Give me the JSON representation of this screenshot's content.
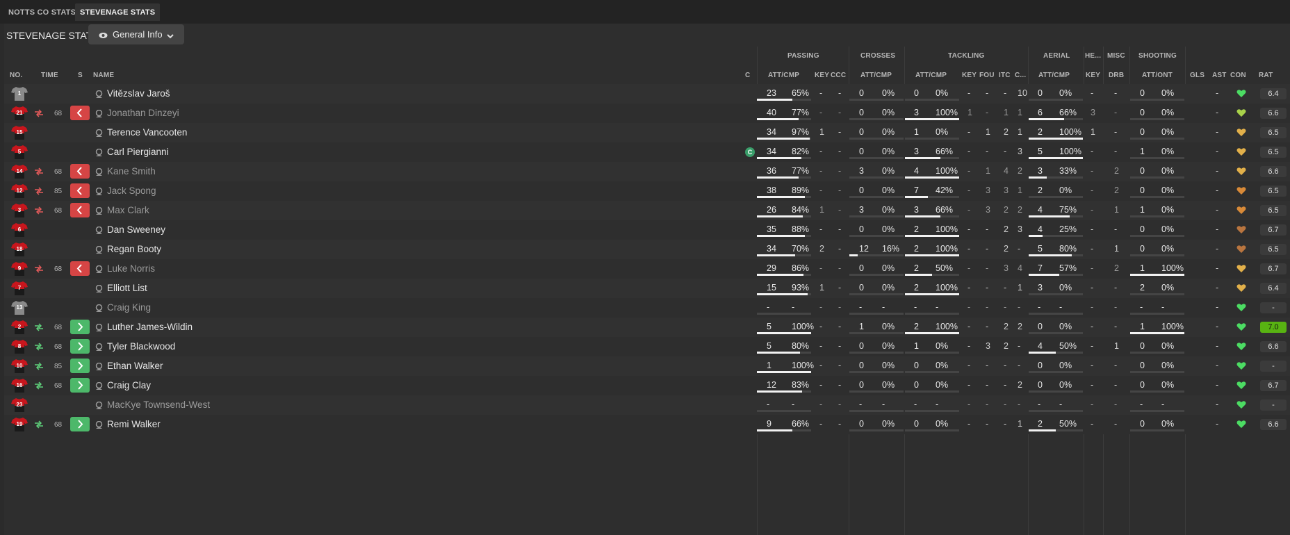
{
  "tabs": [
    {
      "label": "NOTTS CO STATS",
      "active": false
    },
    {
      "label": "STEVENAGE STATS",
      "active": true
    }
  ],
  "panel_title": "STEVENAGE STATS",
  "view_selector": {
    "label": "General Info",
    "icon": "eye-icon"
  },
  "group_headers": {
    "passing": "PASSING",
    "crosses": "CROSSES",
    "tackling": "TACKLING",
    "aerial": "AERIAL",
    "headers": "HE...",
    "misc": "MISC",
    "shooting": "SHOOTING"
  },
  "columns": {
    "no": "NO.",
    "time": "TIME",
    "s": "S",
    "name": "NAME",
    "c": "C",
    "pass_attcmp": "ATT/CMP",
    "pass_key": "KEY",
    "pass_ccc": "CCC",
    "cross_attcmp": "ATT/CMP",
    "tack_attcmp": "ATT/CMP",
    "tack_key": "KEY",
    "tack_fou": "FOU",
    "tack_itc": "ITC",
    "tack_c": "C...",
    "aer_attcmp": "ATT/CMP",
    "head_key": "KEY",
    "misc_drb": "DRB",
    "shoot_attont": "ATT/ONT",
    "gls": "GLS",
    "ast": "AST",
    "con": "CON",
    "rat": "RAT"
  },
  "colors": {
    "sub_off": "#d64545",
    "sub_on": "#4db86a",
    "shirt_red": "#c8161d",
    "shirt_grey": "#8a8a8a",
    "rating_best": "#58b312",
    "captain": "#3a9e6a"
  },
  "players": [
    {
      "no": "1",
      "shirt": "grey",
      "sub": "",
      "time": "",
      "name": "Vitězslav Jaroš",
      "dim": false,
      "captain": false,
      "p_att": "23",
      "p_pct": "65%",
      "p_frac": 0.65,
      "p_key": "-",
      "p_ccc": "-",
      "c_att": "0",
      "c_pct": "0%",
      "c_frac": 0,
      "t_att": "0",
      "t_pct": "0%",
      "t_frac": 0,
      "t_key": "-",
      "t_fou": "-",
      "t_itc": "-",
      "t_c": "10",
      "a_att": "0",
      "a_pct": "0%",
      "a_frac": 0,
      "h_key": "-",
      "m_drb": "-",
      "s_att": "0",
      "s_pct": "0%",
      "s_frac": 0,
      "gls": "",
      "ast": "-",
      "con": "green",
      "rat": "6.4",
      "best": false
    },
    {
      "no": "21",
      "shirt": "red",
      "sub": "off",
      "time": "68",
      "name": "Jonathan Dinzeyi",
      "dim": true,
      "captain": false,
      "p_att": "40",
      "p_pct": "77%",
      "p_frac": 0.77,
      "p_key": "-",
      "p_ccc": "-",
      "c_att": "0",
      "c_pct": "0%",
      "c_frac": 0,
      "t_att": "3",
      "t_pct": "100%",
      "t_frac": 1,
      "t_key": "1",
      "t_fou": "-",
      "t_itc": "1",
      "t_c": "1",
      "a_att": "6",
      "a_pct": "66%",
      "a_frac": 0.66,
      "h_key": "3",
      "m_drb": "-",
      "s_att": "0",
      "s_pct": "0%",
      "s_frac": 0,
      "gls": "",
      "ast": "-",
      "con": "yellowgreen",
      "rat": "6.6",
      "best": false
    },
    {
      "no": "15",
      "shirt": "red",
      "sub": "",
      "time": "",
      "name": "Terence Vancooten",
      "dim": false,
      "captain": false,
      "p_att": "34",
      "p_pct": "97%",
      "p_frac": 0.97,
      "p_key": "1",
      "p_ccc": "-",
      "c_att": "0",
      "c_pct": "0%",
      "c_frac": 0,
      "t_att": "1",
      "t_pct": "0%",
      "t_frac": 0,
      "t_key": "-",
      "t_fou": "1",
      "t_itc": "2",
      "t_c": "1",
      "a_att": "2",
      "a_pct": "100%",
      "a_frac": 1,
      "h_key": "1",
      "m_drb": "-",
      "s_att": "0",
      "s_pct": "0%",
      "s_frac": 0,
      "gls": "",
      "ast": "-",
      "con": "orange",
      "rat": "6.5",
      "best": false
    },
    {
      "no": "5",
      "shirt": "red",
      "sub": "",
      "time": "",
      "name": "Carl Piergianni",
      "dim": false,
      "captain": true,
      "p_att": "34",
      "p_pct": "82%",
      "p_frac": 0.82,
      "p_key": "-",
      "p_ccc": "-",
      "c_att": "0",
      "c_pct": "0%",
      "c_frac": 0,
      "t_att": "3",
      "t_pct": "66%",
      "t_frac": 0.66,
      "t_key": "-",
      "t_fou": "-",
      "t_itc": "-",
      "t_c": "3",
      "a_att": "5",
      "a_pct": "100%",
      "a_frac": 1,
      "h_key": "-",
      "m_drb": "-",
      "s_att": "1",
      "s_pct": "0%",
      "s_frac": 0,
      "gls": "",
      "ast": "-",
      "con": "orange",
      "rat": "6.5",
      "best": false,
      "captain_label": "C"
    },
    {
      "no": "14",
      "shirt": "red",
      "sub": "off",
      "time": "68",
      "name": "Kane Smith",
      "dim": true,
      "captain": false,
      "p_att": "36",
      "p_pct": "77%",
      "p_frac": 0.77,
      "p_key": "-",
      "p_ccc": "-",
      "c_att": "3",
      "c_pct": "0%",
      "c_frac": 0,
      "t_att": "4",
      "t_pct": "100%",
      "t_frac": 1,
      "t_key": "-",
      "t_fou": "1",
      "t_itc": "4",
      "t_c": "2",
      "a_att": "3",
      "a_pct": "33%",
      "a_frac": 0.33,
      "h_key": "-",
      "m_drb": "2",
      "s_att": "0",
      "s_pct": "0%",
      "s_frac": 0,
      "gls": "",
      "ast": "-",
      "con": "orange",
      "rat": "6.6",
      "best": false
    },
    {
      "no": "12",
      "shirt": "red",
      "sub": "off",
      "time": "85",
      "name": "Jack Spong",
      "dim": true,
      "captain": false,
      "p_att": "38",
      "p_pct": "89%",
      "p_frac": 0.89,
      "p_key": "-",
      "p_ccc": "-",
      "c_att": "0",
      "c_pct": "0%",
      "c_frac": 0,
      "t_att": "7",
      "t_pct": "42%",
      "t_frac": 0.42,
      "t_key": "-",
      "t_fou": "3",
      "t_itc": "3",
      "t_c": "1",
      "a_att": "2",
      "a_pct": "0%",
      "a_frac": 0,
      "h_key": "-",
      "m_drb": "2",
      "s_att": "0",
      "s_pct": "0%",
      "s_frac": 0,
      "gls": "",
      "ast": "-",
      "con": "darkorange",
      "rat": "6.5",
      "best": false
    },
    {
      "no": "3",
      "shirt": "red",
      "sub": "off",
      "time": "68",
      "name": "Max Clark",
      "dim": true,
      "captain": false,
      "p_att": "26",
      "p_pct": "84%",
      "p_frac": 0.84,
      "p_key": "1",
      "p_ccc": "-",
      "c_att": "3",
      "c_pct": "0%",
      "c_frac": 0,
      "t_att": "3",
      "t_pct": "66%",
      "t_frac": 0.66,
      "t_key": "-",
      "t_fou": "3",
      "t_itc": "2",
      "t_c": "2",
      "a_att": "4",
      "a_pct": "75%",
      "a_frac": 0.75,
      "h_key": "-",
      "m_drb": "1",
      "s_att": "1",
      "s_pct": "0%",
      "s_frac": 0,
      "gls": "",
      "ast": "-",
      "con": "darkorange",
      "rat": "6.5",
      "best": false
    },
    {
      "no": "6",
      "shirt": "red",
      "sub": "",
      "time": "",
      "name": "Dan Sweeney",
      "dim": false,
      "captain": false,
      "p_att": "35",
      "p_pct": "88%",
      "p_frac": 0.88,
      "p_key": "-",
      "p_ccc": "-",
      "c_att": "0",
      "c_pct": "0%",
      "c_frac": 0,
      "t_att": "2",
      "t_pct": "100%",
      "t_frac": 1,
      "t_key": "-",
      "t_fou": "-",
      "t_itc": "2",
      "t_c": "3",
      "a_att": "4",
      "a_pct": "25%",
      "a_frac": 0.25,
      "h_key": "-",
      "m_drb": "-",
      "s_att": "0",
      "s_pct": "0%",
      "s_frac": 0,
      "gls": "",
      "ast": "-",
      "con": "brown",
      "rat": "6.7",
      "best": false
    },
    {
      "no": "18",
      "shirt": "red",
      "sub": "",
      "time": "",
      "name": "Regan Booty",
      "dim": false,
      "captain": false,
      "p_att": "34",
      "p_pct": "70%",
      "p_frac": 0.7,
      "p_key": "2",
      "p_ccc": "-",
      "c_att": "12",
      "c_pct": "16%",
      "c_frac": 0.16,
      "t_att": "2",
      "t_pct": "100%",
      "t_frac": 1,
      "t_key": "-",
      "t_fou": "-",
      "t_itc": "2",
      "t_c": "-",
      "a_att": "5",
      "a_pct": "80%",
      "a_frac": 0.8,
      "h_key": "-",
      "m_drb": "1",
      "s_att": "0",
      "s_pct": "0%",
      "s_frac": 0,
      "gls": "",
      "ast": "-",
      "con": "brown",
      "rat": "6.5",
      "best": false
    },
    {
      "no": "9",
      "shirt": "red",
      "sub": "off",
      "time": "68",
      "name": "Luke Norris",
      "dim": true,
      "captain": false,
      "p_att": "29",
      "p_pct": "86%",
      "p_frac": 0.86,
      "p_key": "-",
      "p_ccc": "-",
      "c_att": "0",
      "c_pct": "0%",
      "c_frac": 0,
      "t_att": "2",
      "t_pct": "50%",
      "t_frac": 0.5,
      "t_key": "-",
      "t_fou": "-",
      "t_itc": "3",
      "t_c": "4",
      "a_att": "7",
      "a_pct": "57%",
      "a_frac": 0.57,
      "h_key": "-",
      "m_drb": "2",
      "s_att": "1",
      "s_pct": "100%",
      "s_frac": 1,
      "gls": "",
      "ast": "-",
      "con": "orange",
      "rat": "6.7",
      "best": false
    },
    {
      "no": "7",
      "shirt": "red",
      "sub": "",
      "time": "",
      "name": "Elliott List",
      "dim": false,
      "captain": false,
      "p_att": "15",
      "p_pct": "93%",
      "p_frac": 0.93,
      "p_key": "1",
      "p_ccc": "-",
      "c_att": "0",
      "c_pct": "0%",
      "c_frac": 0,
      "t_att": "2",
      "t_pct": "100%",
      "t_frac": 1,
      "t_key": "-",
      "t_fou": "-",
      "t_itc": "-",
      "t_c": "1",
      "a_att": "3",
      "a_pct": "0%",
      "a_frac": 0,
      "h_key": "-",
      "m_drb": "-",
      "s_att": "2",
      "s_pct": "0%",
      "s_frac": 0,
      "gls": "",
      "ast": "-",
      "con": "orange",
      "rat": "6.4",
      "best": false
    },
    {
      "no": "13",
      "shirt": "grey",
      "sub": "",
      "time": "",
      "name": "Craig King",
      "dim": true,
      "captain": false,
      "unused": true,
      "p_att": "-",
      "p_pct": "-",
      "p_frac": 0,
      "p_key": "-",
      "p_ccc": "-",
      "c_att": "-",
      "c_pct": "-",
      "c_frac": 0,
      "t_att": "-",
      "t_pct": "-",
      "t_frac": 0,
      "t_key": "-",
      "t_fou": "-",
      "t_itc": "-",
      "t_c": "-",
      "a_att": "-",
      "a_pct": "-",
      "a_frac": 0,
      "h_key": "-",
      "m_drb": "-",
      "s_att": "-",
      "s_pct": "-",
      "s_frac": 0,
      "gls": "",
      "ast": "-",
      "con": "green",
      "rat": "-",
      "best": false
    },
    {
      "no": "2",
      "shirt": "red",
      "sub": "on",
      "time": "68",
      "name": "Luther James-Wildin",
      "dim": false,
      "captain": false,
      "p_att": "5",
      "p_pct": "100%",
      "p_frac": 1,
      "p_key": "-",
      "p_ccc": "-",
      "c_att": "1",
      "c_pct": "0%",
      "c_frac": 0,
      "t_att": "2",
      "t_pct": "100%",
      "t_frac": 1,
      "t_key": "-",
      "t_fou": "-",
      "t_itc": "2",
      "t_c": "2",
      "a_att": "0",
      "a_pct": "0%",
      "a_frac": 0,
      "h_key": "-",
      "m_drb": "-",
      "s_att": "1",
      "s_pct": "100%",
      "s_frac": 1,
      "gls": "",
      "ast": "-",
      "con": "green",
      "rat": "7.0",
      "best": true
    },
    {
      "no": "8",
      "shirt": "red",
      "sub": "on",
      "time": "68",
      "name": "Tyler Blackwood",
      "dim": false,
      "captain": false,
      "p_att": "5",
      "p_pct": "80%",
      "p_frac": 0.8,
      "p_key": "-",
      "p_ccc": "-",
      "c_att": "0",
      "c_pct": "0%",
      "c_frac": 0,
      "t_att": "1",
      "t_pct": "0%",
      "t_frac": 0,
      "t_key": "-",
      "t_fou": "3",
      "t_itc": "2",
      "t_c": "-",
      "a_att": "4",
      "a_pct": "50%",
      "a_frac": 0.5,
      "h_key": "-",
      "m_drb": "1",
      "s_att": "0",
      "s_pct": "0%",
      "s_frac": 0,
      "gls": "",
      "ast": "-",
      "con": "green",
      "rat": "6.6",
      "best": false
    },
    {
      "no": "10",
      "shirt": "red",
      "sub": "on",
      "time": "85",
      "name": "Ethan Walker",
      "dim": false,
      "captain": false,
      "p_att": "1",
      "p_pct": "100%",
      "p_frac": 1,
      "p_key": "-",
      "p_ccc": "-",
      "c_att": "0",
      "c_pct": "0%",
      "c_frac": 0,
      "t_att": "0",
      "t_pct": "0%",
      "t_frac": 0,
      "t_key": "-",
      "t_fou": "-",
      "t_itc": "-",
      "t_c": "-",
      "a_att": "0",
      "a_pct": "0%",
      "a_frac": 0,
      "h_key": "-",
      "m_drb": "-",
      "s_att": "0",
      "s_pct": "0%",
      "s_frac": 0,
      "gls": "",
      "ast": "-",
      "con": "green",
      "rat": "-",
      "best": false
    },
    {
      "no": "16",
      "shirt": "red",
      "sub": "on",
      "time": "68",
      "name": "Craig Clay",
      "dim": false,
      "captain": false,
      "p_att": "12",
      "p_pct": "83%",
      "p_frac": 0.83,
      "p_key": "-",
      "p_ccc": "-",
      "c_att": "0",
      "c_pct": "0%",
      "c_frac": 0,
      "t_att": "0",
      "t_pct": "0%",
      "t_frac": 0,
      "t_key": "-",
      "t_fou": "-",
      "t_itc": "-",
      "t_c": "2",
      "a_att": "0",
      "a_pct": "0%",
      "a_frac": 0,
      "h_key": "-",
      "m_drb": "-",
      "s_att": "0",
      "s_pct": "0%",
      "s_frac": 0,
      "gls": "",
      "ast": "-",
      "con": "green",
      "rat": "6.7",
      "best": false
    },
    {
      "no": "23",
      "shirt": "red",
      "sub": "",
      "time": "",
      "name": "MacKye Townsend-West",
      "dim": true,
      "captain": false,
      "unused": true,
      "p_att": "-",
      "p_pct": "-",
      "p_frac": 0,
      "p_key": "-",
      "p_ccc": "-",
      "c_att": "-",
      "c_pct": "-",
      "c_frac": 0,
      "t_att": "-",
      "t_pct": "-",
      "t_frac": 0,
      "t_key": "-",
      "t_fou": "-",
      "t_itc": "-",
      "t_c": "-",
      "a_att": "-",
      "a_pct": "-",
      "a_frac": 0,
      "h_key": "-",
      "m_drb": "-",
      "s_att": "-",
      "s_pct": "-",
      "s_frac": 0,
      "gls": "",
      "ast": "-",
      "con": "green",
      "rat": "-",
      "best": false
    },
    {
      "no": "19",
      "shirt": "red",
      "sub": "on",
      "time": "68",
      "name": "Remi Walker",
      "dim": false,
      "captain": false,
      "p_att": "9",
      "p_pct": "66%",
      "p_frac": 0.66,
      "p_key": "-",
      "p_ccc": "-",
      "c_att": "0",
      "c_pct": "0%",
      "c_frac": 0,
      "t_att": "0",
      "t_pct": "0%",
      "t_frac": 0,
      "t_key": "-",
      "t_fou": "-",
      "t_itc": "-",
      "t_c": "1",
      "a_att": "2",
      "a_pct": "50%",
      "a_frac": 0.5,
      "h_key": "-",
      "m_drb": "-",
      "s_att": "0",
      "s_pct": "0%",
      "s_frac": 0,
      "gls": "",
      "ast": "-",
      "con": "green",
      "rat": "6.6",
      "best": false
    }
  ]
}
